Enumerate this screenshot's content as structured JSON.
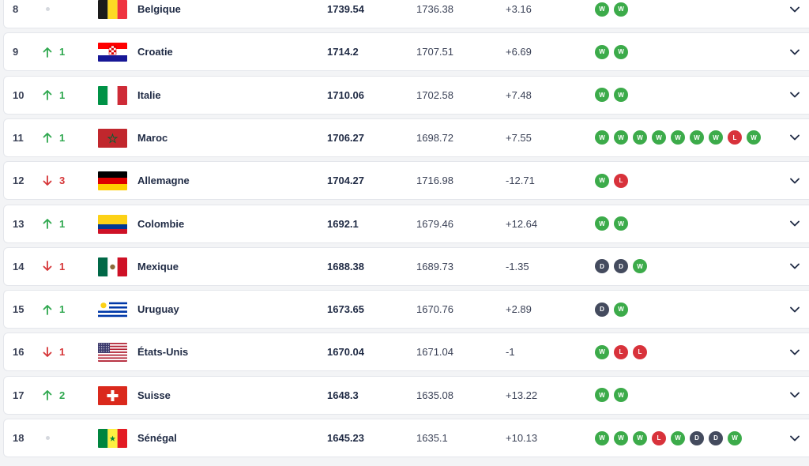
{
  "colors": {
    "up": "#2fa84f",
    "down": "#d63638",
    "win": "#3cab4a",
    "loss": "#d8323b",
    "draw": "#444b5e"
  },
  "icons": {
    "up": "arrow-up-icon",
    "down": "arrow-down-icon",
    "same": "no-change-dot-icon",
    "expand": "chevron-down-icon"
  },
  "rows": [
    {
      "rank": "8",
      "trend": "same",
      "change": "",
      "team": "Belgique",
      "flag": "be",
      "points": "1739.54",
      "previous": "1736.38",
      "diff": "+3.16",
      "form": [
        "W",
        "W"
      ]
    },
    {
      "rank": "9",
      "trend": "up",
      "change": "1",
      "team": "Croatie",
      "flag": "hr",
      "points": "1714.2",
      "previous": "1707.51",
      "diff": "+6.69",
      "form": [
        "W",
        "W"
      ]
    },
    {
      "rank": "10",
      "trend": "up",
      "change": "1",
      "team": "Italie",
      "flag": "it",
      "points": "1710.06",
      "previous": "1702.58",
      "diff": "+7.48",
      "form": [
        "W",
        "W"
      ]
    },
    {
      "rank": "11",
      "trend": "up",
      "change": "1",
      "team": "Maroc",
      "flag": "ma",
      "points": "1706.27",
      "previous": "1698.72",
      "diff": "+7.55",
      "form": [
        "W",
        "W",
        "W",
        "W",
        "W",
        "W",
        "W",
        "L",
        "W"
      ]
    },
    {
      "rank": "12",
      "trend": "down",
      "change": "3",
      "team": "Allemagne",
      "flag": "de",
      "points": "1704.27",
      "previous": "1716.98",
      "diff": "-12.71",
      "form": [
        "W",
        "L"
      ]
    },
    {
      "rank": "13",
      "trend": "up",
      "change": "1",
      "team": "Colombie",
      "flag": "co",
      "points": "1692.1",
      "previous": "1679.46",
      "diff": "+12.64",
      "form": [
        "W",
        "W"
      ]
    },
    {
      "rank": "14",
      "trend": "down",
      "change": "1",
      "team": "Mexique",
      "flag": "mx",
      "points": "1688.38",
      "previous": "1689.73",
      "diff": "-1.35",
      "form": [
        "D",
        "D",
        "W"
      ]
    },
    {
      "rank": "15",
      "trend": "up",
      "change": "1",
      "team": "Uruguay",
      "flag": "uy",
      "points": "1673.65",
      "previous": "1670.76",
      "diff": "+2.89",
      "form": [
        "D",
        "W"
      ]
    },
    {
      "rank": "16",
      "trend": "down",
      "change": "1",
      "team": "États-Unis",
      "flag": "us",
      "points": "1670.04",
      "previous": "1671.04",
      "diff": "-1",
      "form": [
        "W",
        "L",
        "L"
      ]
    },
    {
      "rank": "17",
      "trend": "up",
      "change": "2",
      "team": "Suisse",
      "flag": "ch",
      "points": "1648.3",
      "previous": "1635.08",
      "diff": "+13.22",
      "form": [
        "W",
        "W"
      ]
    },
    {
      "rank": "18",
      "trend": "same",
      "change": "",
      "team": "Sénégal",
      "flag": "sn",
      "points": "1645.23",
      "previous": "1635.1",
      "diff": "+10.13",
      "form": [
        "W",
        "W",
        "W",
        "L",
        "W",
        "D",
        "D",
        "W"
      ]
    }
  ]
}
